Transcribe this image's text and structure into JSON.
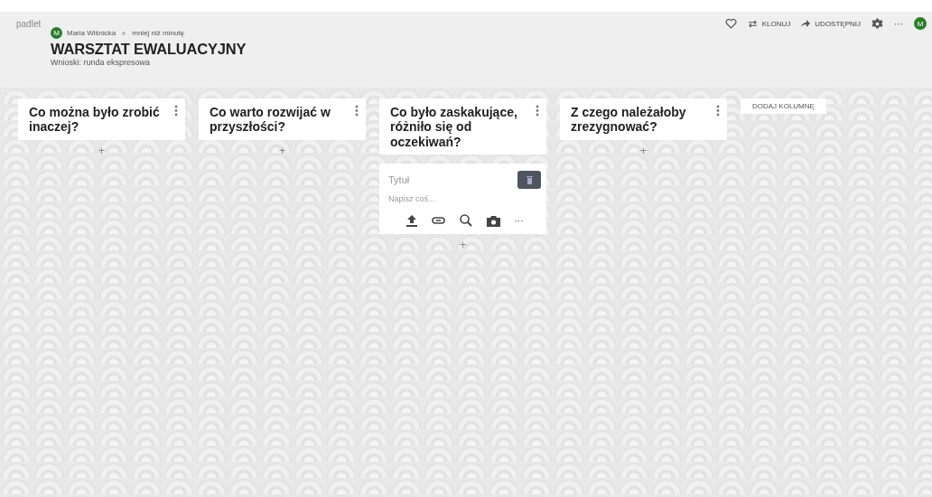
{
  "header": {
    "logo": "padlet",
    "author_initial": "M",
    "author": "Maria Wiśnicka",
    "time": "mniej niż minutę",
    "title": "WARSZTAT EWALUACYJNY",
    "subtitle": "Wnioski: runda ekspresowa"
  },
  "toolbar": {
    "clone": "KLONUJ",
    "share": "UDOSTĘPNIJ",
    "more": "···",
    "avatar_initial": "M"
  },
  "columns": [
    {
      "title": "Co można było zrobić inaczej?",
      "add": "+"
    },
    {
      "title": "Co warto rozwijać w przyszłości?",
      "add": "+"
    },
    {
      "title": "Co było zaskakujące, różniło się od oczekiwań?",
      "add": "+",
      "composer": {
        "title_placeholder": "Tytuł",
        "body_placeholder": "Napisz coś...",
        "more": "···"
      }
    },
    {
      "title": "Z czego należałoby zrezygnować?",
      "add": "+"
    }
  ],
  "add_column": "DODAJ KOLUMNĘ"
}
